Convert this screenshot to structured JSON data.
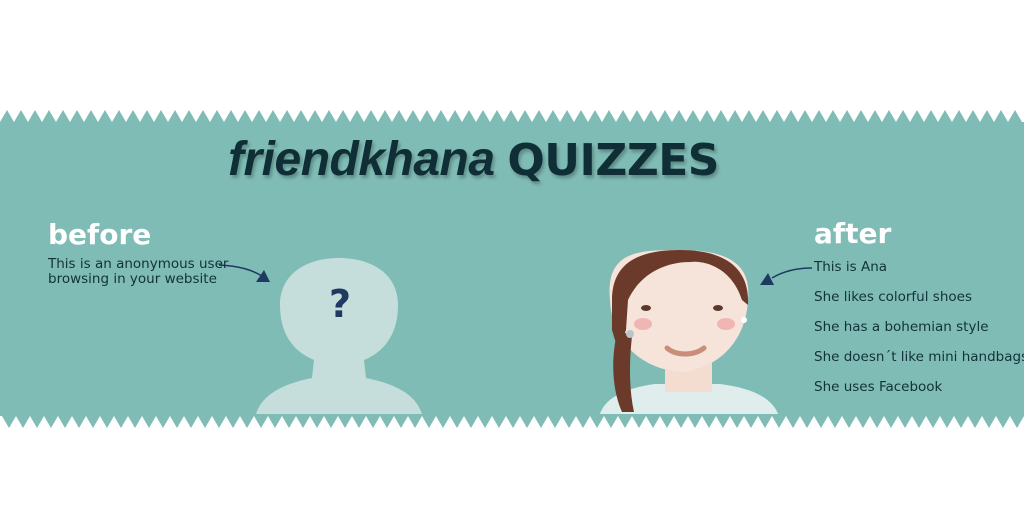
{
  "title": {
    "brand": "friendkhana",
    "product": "QUIZZES"
  },
  "before": {
    "heading": "before",
    "caption_line1": "This is an anonymous user",
    "caption_line2": "browsing in your website",
    "symbol": "?"
  },
  "after": {
    "heading": "after",
    "traits": [
      "This is Ana",
      "She likes colorful shoes",
      "She has a bohemian style",
      "She doesn´t like mini handbags",
      "She uses Facebook"
    ]
  },
  "colors": {
    "banner": "#7fbcb5",
    "silhouette": "#c5dedb",
    "dark_text": "#0f2e36",
    "arrow": "#1f3a60"
  },
  "icons": {
    "anonymous": "user-silhouette-icon",
    "persona": "woman-portrait-icon"
  }
}
